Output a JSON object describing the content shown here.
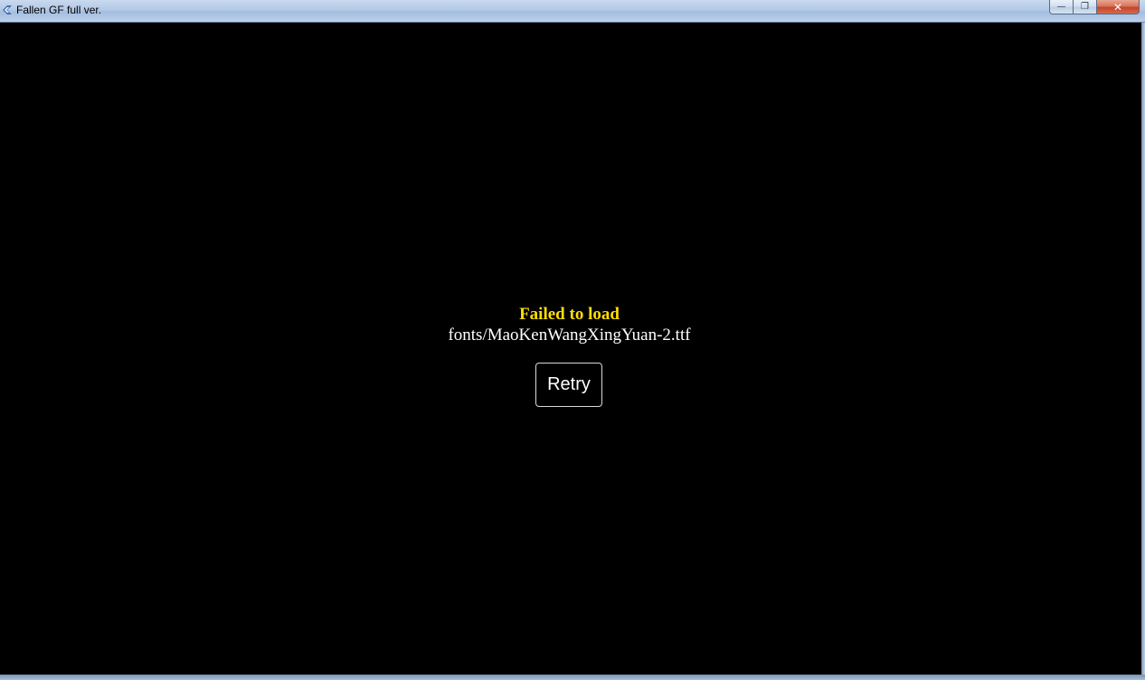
{
  "window": {
    "title": "Fallen GF full ver.",
    "controls": {
      "minimize": "—",
      "maximize": "❐",
      "close": "✕"
    }
  },
  "error": {
    "title": "Failed to load",
    "path": "fonts/MaoKenWangXingYuan-2.ttf",
    "retry_label": "Retry"
  },
  "colors": {
    "background": "#000000",
    "error_title": "#ffde00",
    "error_path": "#ffffff"
  }
}
